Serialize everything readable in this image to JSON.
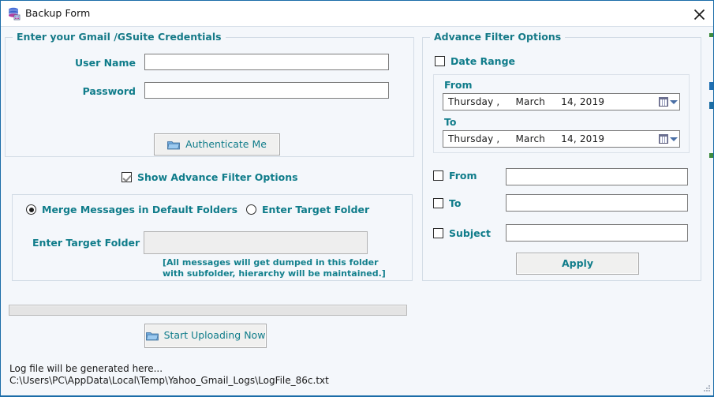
{
  "window": {
    "title": "Backup Form",
    "icon": "database-stack-icon",
    "close_label": "×",
    "accent_color": "#1b6ca8",
    "background_color": "#f4f7fb",
    "label_color": "#0f7c8a"
  },
  "credentials": {
    "group_title": "Enter your Gmail /GSuite Credentials",
    "username_label": "User Name",
    "username_value": "",
    "username_placeholder": "",
    "password_label": "Password",
    "password_value": "",
    "password_placeholder": "",
    "authenticate_button": "Authenticate Me",
    "authenticate_icon": "folder-icon"
  },
  "show_advance": {
    "label": "Show Advance Filter Options",
    "checked": true
  },
  "target": {
    "radio_merge": "Merge Messages in Default Folders",
    "radio_merge_selected": true,
    "radio_target": "Enter Target Folder",
    "radio_target_selected": false,
    "folder_label": "Enter Target Folder",
    "folder_value": "",
    "folder_placeholder": "",
    "folder_disabled": true,
    "note": "[All messages will get dumped in this folder\nwith subfolder, hierarchy will be maintained.]"
  },
  "advance_filter": {
    "group_title": "Advance Filter Options",
    "date_range_label": "Date Range",
    "date_range_checked": false,
    "from_group_label": "From",
    "from_date": "Thursday ,     March     14, 2019",
    "to_group_label": "To",
    "to_date": "Thursday ,     March     14, 2019",
    "calendar_icon": "calendar-icon",
    "dropdown_icon": "chevron-down-icon",
    "from_label": "From",
    "from_checked": false,
    "from_value": "",
    "to_label": "To",
    "to_checked": false,
    "to_value": "",
    "subject_label": "Subject",
    "subject_checked": false,
    "subject_value": "",
    "apply_button": "Apply"
  },
  "footer": {
    "progress_value": 0,
    "start_button": "Start Uploading Now",
    "start_icon": "folder-icon",
    "log_text": "Log file will be generated here...\nC:\\Users\\PC\\AppData\\Local\\Temp\\Yahoo_Gmail_Logs\\LogFile_86c.txt"
  }
}
